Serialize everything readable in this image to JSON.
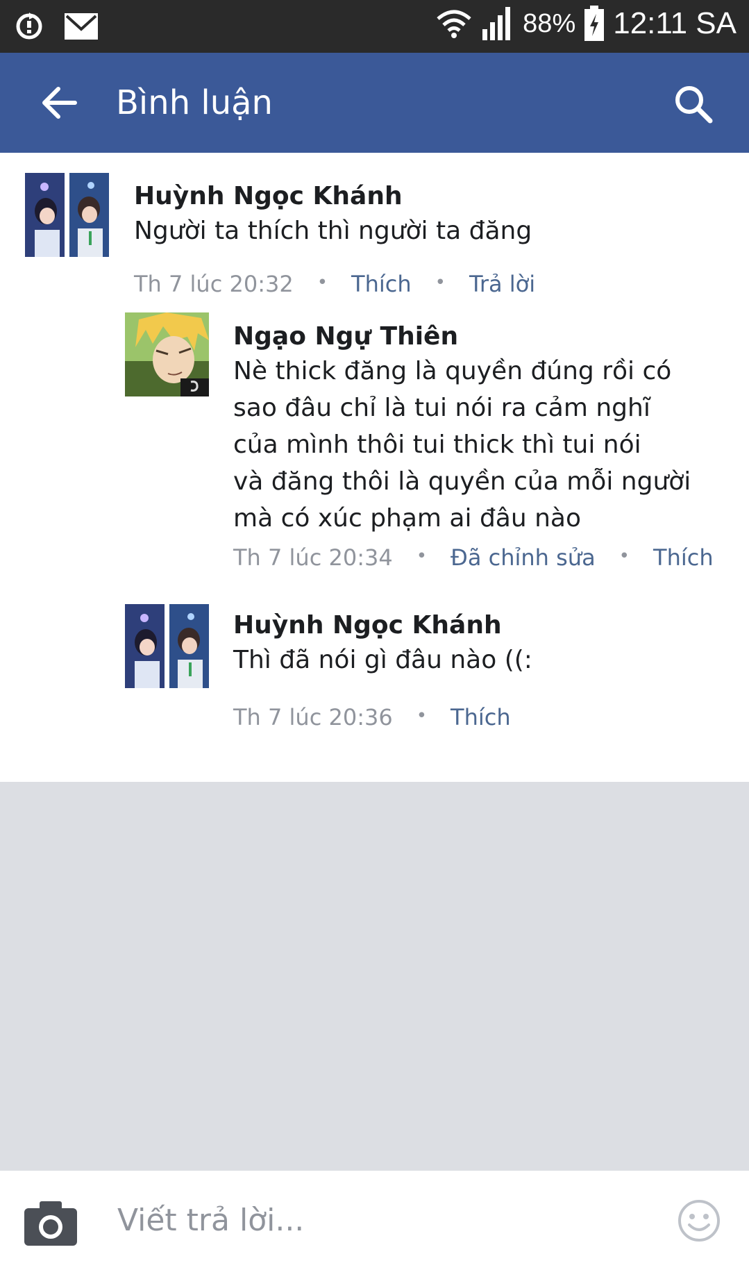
{
  "status_bar": {
    "battery": "88%",
    "time": "12:11 SA"
  },
  "app_bar": {
    "title": "Bình luận"
  },
  "comments": [
    {
      "author": "Huỳnh Ngọc Khánh",
      "text": "Người ta thích thì người ta đăng",
      "time": "Th 7 lúc 20:32",
      "actions": [
        "Thích",
        "Trả lời"
      ]
    },
    {
      "author": "Ngạo Ngự Thiên",
      "text": "Nè thick đăng là quyền đúng rồi có\nsao đâu chỉ là tui nói ra cảm nghĩ\ncủa mình thôi tui thick thì tui  nói\nvà đăng thôi là quyền của mỗi người\nmà có xúc phạm ai đâu nào",
      "time": "Th 7 lúc 20:34",
      "actions": [
        "Đã chỉnh sửa",
        "Thích"
      ]
    },
    {
      "author": "Huỳnh Ngọc Khánh",
      "text": "Thì đã nói gì đâu nào ((:",
      "time": "Th 7 lúc 20:36",
      "actions": [
        "Thích"
      ]
    }
  ],
  "composer": {
    "placeholder": "Viết trả lời..."
  },
  "colors": {
    "app_bar": "#3b5998",
    "link": "#4b6790",
    "meta": "#90949c",
    "empty_area": "#dcdee3"
  }
}
